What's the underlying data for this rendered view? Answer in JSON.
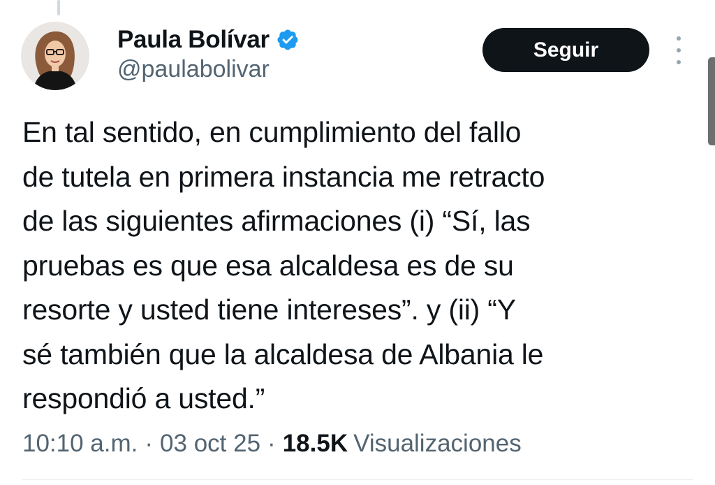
{
  "author": {
    "display_name": "Paula Bolívar",
    "handle": "@paulabolivar",
    "verified": true
  },
  "actions": {
    "follow_label": "Seguir"
  },
  "tweet": {
    "text": "En tal sentido, en cumplimiento del fallo\nde tutela en primera instancia me retracto\nde las siguientes afirmaciones (i) “Sí, las\npruebas es que esa alcaldesa es de su\nresorte y usted tiene intereses”. y (ii) “Y\nsé también que la alcaldesa de Albania le\nrespondió a usted.”"
  },
  "meta": {
    "time": "10:10 a.m.",
    "separator": "·",
    "date": "03 oct 25",
    "views_count": "18.5K",
    "views_label": "Visualizaciones"
  },
  "colors": {
    "verified_badge": "#1d9bf0",
    "follow_button_bg": "#0f1419",
    "secondary_text": "#536471"
  },
  "icons": [
    "verified-badge-icon",
    "more-options-icon"
  ]
}
